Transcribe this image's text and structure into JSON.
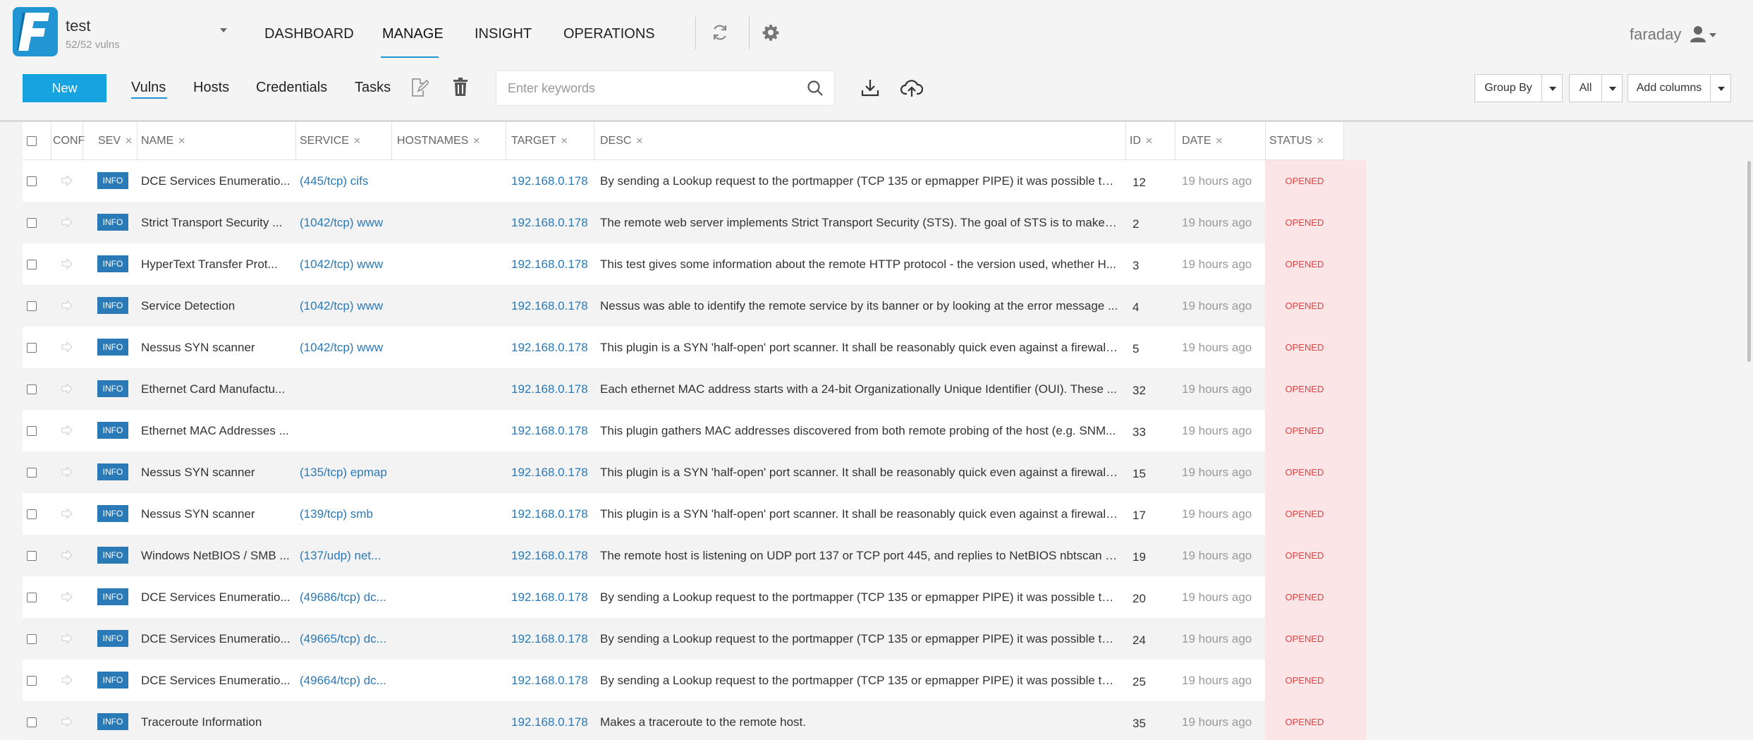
{
  "workspace": {
    "name": "test",
    "count": "52/52 vulns"
  },
  "nav": {
    "dashboard": "DASHBOARD",
    "manage": "MANAGE",
    "insight": "INSIGHT",
    "operations": "OPERATIONS"
  },
  "user": {
    "name": "faraday"
  },
  "toolbar": {
    "new_label": "New",
    "tabs": {
      "vulns": "Vulns",
      "hosts": "Hosts",
      "credentials": "Credentials",
      "tasks": "Tasks"
    },
    "search_placeholder": "Enter keywords",
    "group_by": "Group By",
    "filter": "All",
    "add_columns": "Add columns"
  },
  "table": {
    "headers": {
      "conf": "CONF",
      "sev": "SEV",
      "name": "NAME",
      "service": "SERVICE",
      "hostnames": "HOSTNAMES",
      "target": "TARGET",
      "desc": "DESC",
      "id": "ID",
      "date": "DATE",
      "status": "STATUS"
    },
    "rows": [
      {
        "sev": "INFO",
        "name": "DCE Services Enumeratio...",
        "service": "(445/tcp) cifs",
        "hostnames": "",
        "target": "192.168.0.178",
        "desc": "By sending a Lookup request to the portmapper (TCP 135 or epmapper PIPE) it was possible to ...",
        "id": "12",
        "date": "19 hours ago",
        "status": "OPENED"
      },
      {
        "sev": "INFO",
        "name": "Strict Transport Security ...",
        "service": "(1042/tcp) www",
        "hostnames": "",
        "target": "192.168.0.178",
        "desc": "The remote web server implements Strict Transport Security (STS). The goal of STS is to make su...",
        "id": "2",
        "date": "19 hours ago",
        "status": "OPENED"
      },
      {
        "sev": "INFO",
        "name": "HyperText Transfer Prot...",
        "service": "(1042/tcp) www",
        "hostnames": "",
        "target": "192.168.0.178",
        "desc": "This test gives some information about the remote HTTP protocol - the version used, whether H...",
        "id": "3",
        "date": "19 hours ago",
        "status": "OPENED"
      },
      {
        "sev": "INFO",
        "name": "Service Detection",
        "service": "(1042/tcp) www",
        "hostnames": "",
        "target": "192.168.0.178",
        "desc": "Nessus was able to identify the remote service by its banner or by looking at the error message ...",
        "id": "4",
        "date": "19 hours ago",
        "status": "OPENED"
      },
      {
        "sev": "INFO",
        "name": "Nessus SYN scanner",
        "service": "(1042/tcp) www",
        "hostnames": "",
        "target": "192.168.0.178",
        "desc": "This plugin is a SYN 'half-open' port scanner.  It shall be reasonably quick even against a firewall...",
        "id": "5",
        "date": "19 hours ago",
        "status": "OPENED"
      },
      {
        "sev": "INFO",
        "name": "Ethernet Card Manufactu...",
        "service": "",
        "hostnames": "",
        "target": "192.168.0.178",
        "desc": "Each ethernet MAC address starts with a 24-bit Organizationally Unique Identifier (OUI). These ...",
        "id": "32",
        "date": "19 hours ago",
        "status": "OPENED"
      },
      {
        "sev": "INFO",
        "name": "Ethernet MAC Addresses ...",
        "service": "",
        "hostnames": "",
        "target": "192.168.0.178",
        "desc": "This plugin gathers MAC addresses discovered from both remote probing of the host (e.g. SNM...",
        "id": "33",
        "date": "19 hours ago",
        "status": "OPENED"
      },
      {
        "sev": "INFO",
        "name": "Nessus SYN scanner",
        "service": "(135/tcp) epmap",
        "hostnames": "",
        "target": "192.168.0.178",
        "desc": "This plugin is a SYN 'half-open' port scanner.  It shall be reasonably quick even against a firewall...",
        "id": "15",
        "date": "19 hours ago",
        "status": "OPENED"
      },
      {
        "sev": "INFO",
        "name": "Nessus SYN scanner",
        "service": "(139/tcp) smb",
        "hostnames": "",
        "target": "192.168.0.178",
        "desc": "This plugin is a SYN 'half-open' port scanner.  It shall be reasonably quick even against a firewall...",
        "id": "17",
        "date": "19 hours ago",
        "status": "OPENED"
      },
      {
        "sev": "INFO",
        "name": "Windows NetBIOS / SMB ...",
        "service": "(137/udp) net...",
        "hostnames": "",
        "target": "192.168.0.178",
        "desc": "The remote host is listening on UDP port 137 or TCP port 445, and replies to NetBIOS nbtscan o...",
        "id": "19",
        "date": "19 hours ago",
        "status": "OPENED"
      },
      {
        "sev": "INFO",
        "name": "DCE Services Enumeratio...",
        "service": "(49686/tcp) dc...",
        "hostnames": "",
        "target": "192.168.0.178",
        "desc": "By sending a Lookup request to the portmapper (TCP 135 or epmapper PIPE) it was possible to ...",
        "id": "20",
        "date": "19 hours ago",
        "status": "OPENED"
      },
      {
        "sev": "INFO",
        "name": "DCE Services Enumeratio...",
        "service": "(49665/tcp) dc...",
        "hostnames": "",
        "target": "192.168.0.178",
        "desc": "By sending a Lookup request to the portmapper (TCP 135 or epmapper PIPE) it was possible to ...",
        "id": "24",
        "date": "19 hours ago",
        "status": "OPENED"
      },
      {
        "sev": "INFO",
        "name": "DCE Services Enumeratio...",
        "service": "(49664/tcp) dc...",
        "hostnames": "",
        "target": "192.168.0.178",
        "desc": "By sending a Lookup request to the portmapper (TCP 135 or epmapper PIPE) it was possible to ...",
        "id": "25",
        "date": "19 hours ago",
        "status": "OPENED"
      },
      {
        "sev": "INFO",
        "name": "Traceroute Information",
        "service": "",
        "hostnames": "",
        "target": "192.168.0.178",
        "desc": "Makes a traceroute to the remote host.",
        "id": "35",
        "date": "19 hours ago",
        "status": "OPENED"
      }
    ]
  },
  "colors": {
    "accent": "#2196d3",
    "new_button": "#17a2e0",
    "badge_info": "#2a7ab8",
    "status_opened": "#e43f3f",
    "status_bg": "#fbe5e6",
    "link": "#2979b9"
  },
  "icons": [
    "faraday-logo",
    "chevron-down-icon",
    "refresh-icon",
    "gear-icon",
    "user-icon",
    "edit-icon",
    "trash-icon",
    "search-icon",
    "download-icon",
    "upload-cloud-icon",
    "arrow-right-icon",
    "close-icon"
  ]
}
